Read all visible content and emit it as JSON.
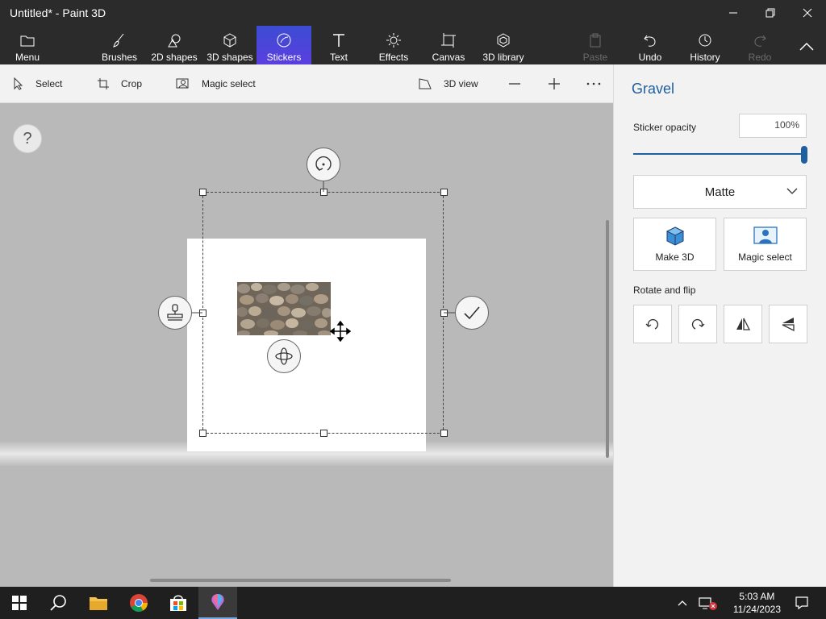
{
  "window": {
    "title": "Untitled* - Paint 3D"
  },
  "ribbon": {
    "menu": "Menu",
    "tools": [
      {
        "label": "Brushes"
      },
      {
        "label": "2D shapes"
      },
      {
        "label": "3D shapes"
      },
      {
        "label": "Stickers"
      },
      {
        "label": "Text"
      },
      {
        "label": "Effects"
      },
      {
        "label": "Canvas"
      },
      {
        "label": "3D library"
      }
    ],
    "paste": "Paste",
    "undo": "Undo",
    "history": "History",
    "redo": "Redo"
  },
  "subtoolbar": {
    "select": "Select",
    "crop": "Crop",
    "magic_select": "Magic select",
    "view3d": "3D view"
  },
  "canvas": {
    "help": "?"
  },
  "panel": {
    "title": "Gravel",
    "opacity_label": "Sticker opacity",
    "opacity_value": "100%",
    "opacity_fraction": 1.0,
    "finish": "Matte",
    "make3d": "Make 3D",
    "magic_select": "Magic select",
    "rotate_label": "Rotate and flip"
  },
  "taskbar": {
    "time": "5:03 AM",
    "date": "11/24/2023"
  },
  "colors": {
    "accent": "#1f5fa0",
    "active_tool": "#4a46d8",
    "titlebar": "#2b2b2b"
  }
}
